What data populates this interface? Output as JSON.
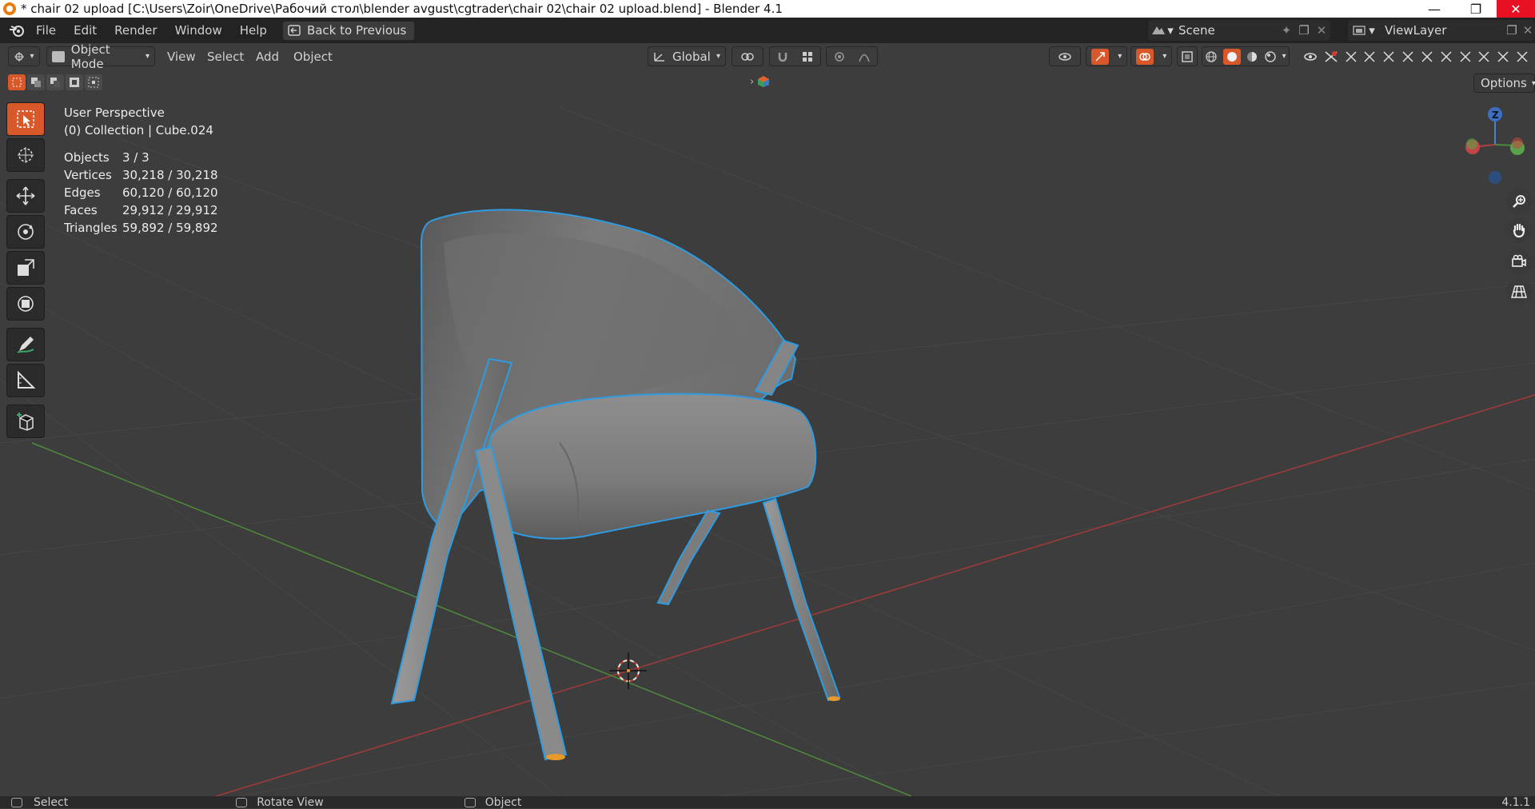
{
  "window": {
    "title": "* chair 02 upload [C:\\Users\\Zoir\\OneDrive\\Рабочий стол\\blender avgust\\cgtrader\\chair 02\\chair 02 upload.blend] - Blender 4.1"
  },
  "menu": {
    "items": [
      "File",
      "Edit",
      "Render",
      "Window",
      "Help"
    ],
    "back_label": "Back to Previous",
    "scene_label": "Scene",
    "viewlayer_label": "ViewLayer"
  },
  "header": {
    "mode_label": "Object Mode",
    "view_label": "View",
    "select_label": "Select",
    "add_label": "Add",
    "object_label": "Object",
    "orientation_label": "Global",
    "options_label": "Options"
  },
  "viewport": {
    "perspective": "User Perspective",
    "collection": "(0) Collection | Cube.024",
    "stats": [
      {
        "label": "Objects",
        "value": "3 / 3"
      },
      {
        "label": "Vertices",
        "value": "30,218 / 30,218"
      },
      {
        "label": "Edges",
        "value": "60,120 / 60,120"
      },
      {
        "label": "Faces",
        "value": "29,912 / 29,912"
      },
      {
        "label": "Triangles",
        "value": "59,892 / 59,892"
      }
    ],
    "gizmo_z": "Z"
  },
  "status": {
    "select": "Select",
    "rotate": "Rotate View",
    "object": "Object",
    "version": "4.1.1"
  },
  "colors": {
    "accent": "#d9582a",
    "selection_outline": "#2f9be0",
    "x_axis": "#a23a3a",
    "y_axis": "#4e8a3a"
  }
}
